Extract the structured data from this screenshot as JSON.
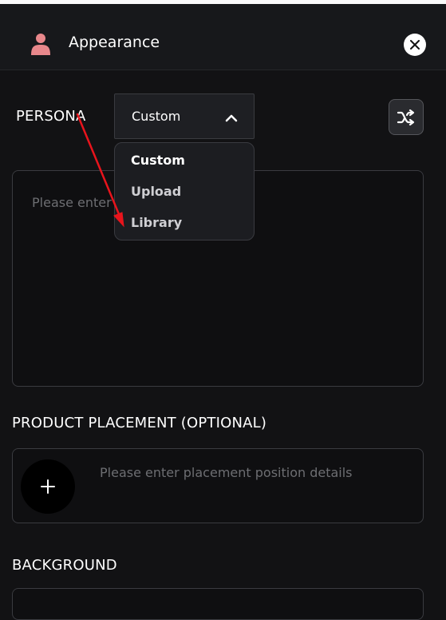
{
  "header": {
    "title": "Appearance",
    "avatar_icon": "person-icon",
    "close_icon": "close-icon"
  },
  "persona": {
    "label": "PERSONA",
    "selected": "Custom",
    "options": [
      "Custom",
      "Upload",
      "Library"
    ],
    "textarea_placeholder": "Please enter",
    "shuffle_icon": "shuffle-icon"
  },
  "product_placement": {
    "label": "PRODUCT PLACEMENT (OPTIONAL)",
    "placeholder": "Please enter placement position details",
    "add_icon": "plus-icon"
  },
  "background": {
    "label": "BACKGROUND"
  },
  "colors": {
    "accent_avatar": "#e8878b",
    "annotation_arrow": "#e8141c",
    "panel_bg": "#121214"
  }
}
